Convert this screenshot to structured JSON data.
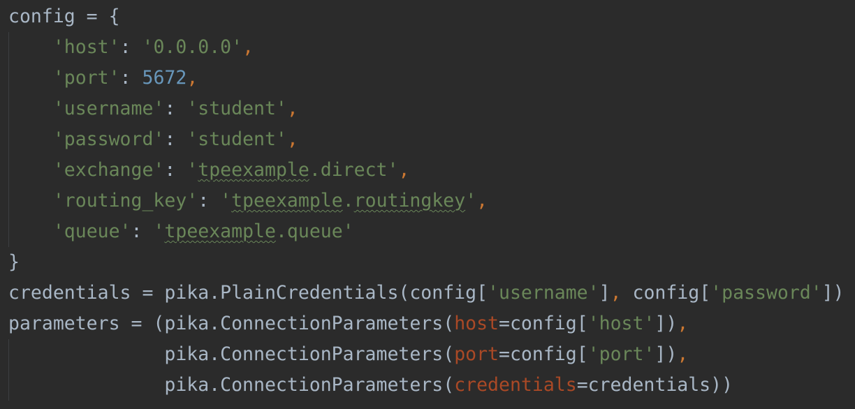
{
  "theme": {
    "background": "#2b2b2b",
    "plain": "#a9b7c6",
    "string": "#6a8759",
    "number": "#6897bb",
    "punctuation": "#cc7832",
    "keyword_arg": "#aa4926",
    "indent_guide": "#3c3f41"
  },
  "lines": [
    [
      {
        "t": "plain",
        "v": "config = {"
      }
    ],
    [
      {
        "t": "plain",
        "v": "    "
      },
      {
        "t": "str",
        "v": "'host'"
      },
      {
        "t": "plain",
        "v": ": "
      },
      {
        "t": "str",
        "v": "'0.0.0.0'"
      },
      {
        "t": "punc",
        "v": ","
      }
    ],
    [
      {
        "t": "plain",
        "v": "    "
      },
      {
        "t": "str",
        "v": "'port'"
      },
      {
        "t": "plain",
        "v": ": "
      },
      {
        "t": "num",
        "v": "5672"
      },
      {
        "t": "punc",
        "v": ","
      }
    ],
    [
      {
        "t": "plain",
        "v": "    "
      },
      {
        "t": "str",
        "v": "'username'"
      },
      {
        "t": "plain",
        "v": ": "
      },
      {
        "t": "str",
        "v": "'student'"
      },
      {
        "t": "punc",
        "v": ","
      }
    ],
    [
      {
        "t": "plain",
        "v": "    "
      },
      {
        "t": "str",
        "v": "'password'"
      },
      {
        "t": "plain",
        "v": ": "
      },
      {
        "t": "str",
        "v": "'student'"
      },
      {
        "t": "punc",
        "v": ","
      }
    ],
    [
      {
        "t": "plain",
        "v": "    "
      },
      {
        "t": "str",
        "v": "'exchange'"
      },
      {
        "t": "plain",
        "v": ": "
      },
      {
        "t": "str",
        "v": "'"
      },
      {
        "t": "str",
        "v": "tpeexample",
        "typo": true
      },
      {
        "t": "str",
        "v": ".direct'"
      },
      {
        "t": "punc",
        "v": ","
      }
    ],
    [
      {
        "t": "plain",
        "v": "    "
      },
      {
        "t": "str",
        "v": "'routing_key'"
      },
      {
        "t": "plain",
        "v": ": "
      },
      {
        "t": "str",
        "v": "'"
      },
      {
        "t": "str",
        "v": "tpeexample",
        "typo": true
      },
      {
        "t": "str",
        "v": "."
      },
      {
        "t": "str",
        "v": "routingkey",
        "typo": true
      },
      {
        "t": "str",
        "v": "'"
      },
      {
        "t": "punc",
        "v": ","
      }
    ],
    [
      {
        "t": "plain",
        "v": "    "
      },
      {
        "t": "str",
        "v": "'queue'"
      },
      {
        "t": "plain",
        "v": ": "
      },
      {
        "t": "str",
        "v": "'"
      },
      {
        "t": "str",
        "v": "tpeexample",
        "typo": true
      },
      {
        "t": "str",
        "v": ".queue'"
      }
    ],
    [
      {
        "t": "plain",
        "v": "}"
      }
    ],
    [
      {
        "t": "plain",
        "v": "credentials = pika.PlainCredentials(config["
      },
      {
        "t": "str",
        "v": "'username'"
      },
      {
        "t": "plain",
        "v": "]"
      },
      {
        "t": "punc",
        "v": ","
      },
      {
        "t": "plain",
        "v": " config["
      },
      {
        "t": "str",
        "v": "'password'"
      },
      {
        "t": "plain",
        "v": "])"
      }
    ],
    [
      {
        "t": "plain",
        "v": "parameters = (pika.ConnectionParameters("
      },
      {
        "t": "kw",
        "v": "host"
      },
      {
        "t": "plain",
        "v": "=config["
      },
      {
        "t": "str",
        "v": "'host'"
      },
      {
        "t": "plain",
        "v": "])"
      },
      {
        "t": "punc",
        "v": ","
      }
    ],
    [
      {
        "t": "plain",
        "v": "              pika.ConnectionParameters("
      },
      {
        "t": "kw",
        "v": "port"
      },
      {
        "t": "plain",
        "v": "=config["
      },
      {
        "t": "str",
        "v": "'port'"
      },
      {
        "t": "plain",
        "v": "])"
      },
      {
        "t": "punc",
        "v": ","
      }
    ],
    [
      {
        "t": "plain",
        "v": "              pika.ConnectionParameters("
      },
      {
        "t": "kw",
        "v": "credentials"
      },
      {
        "t": "plain",
        "v": "=credentials))"
      }
    ]
  ]
}
